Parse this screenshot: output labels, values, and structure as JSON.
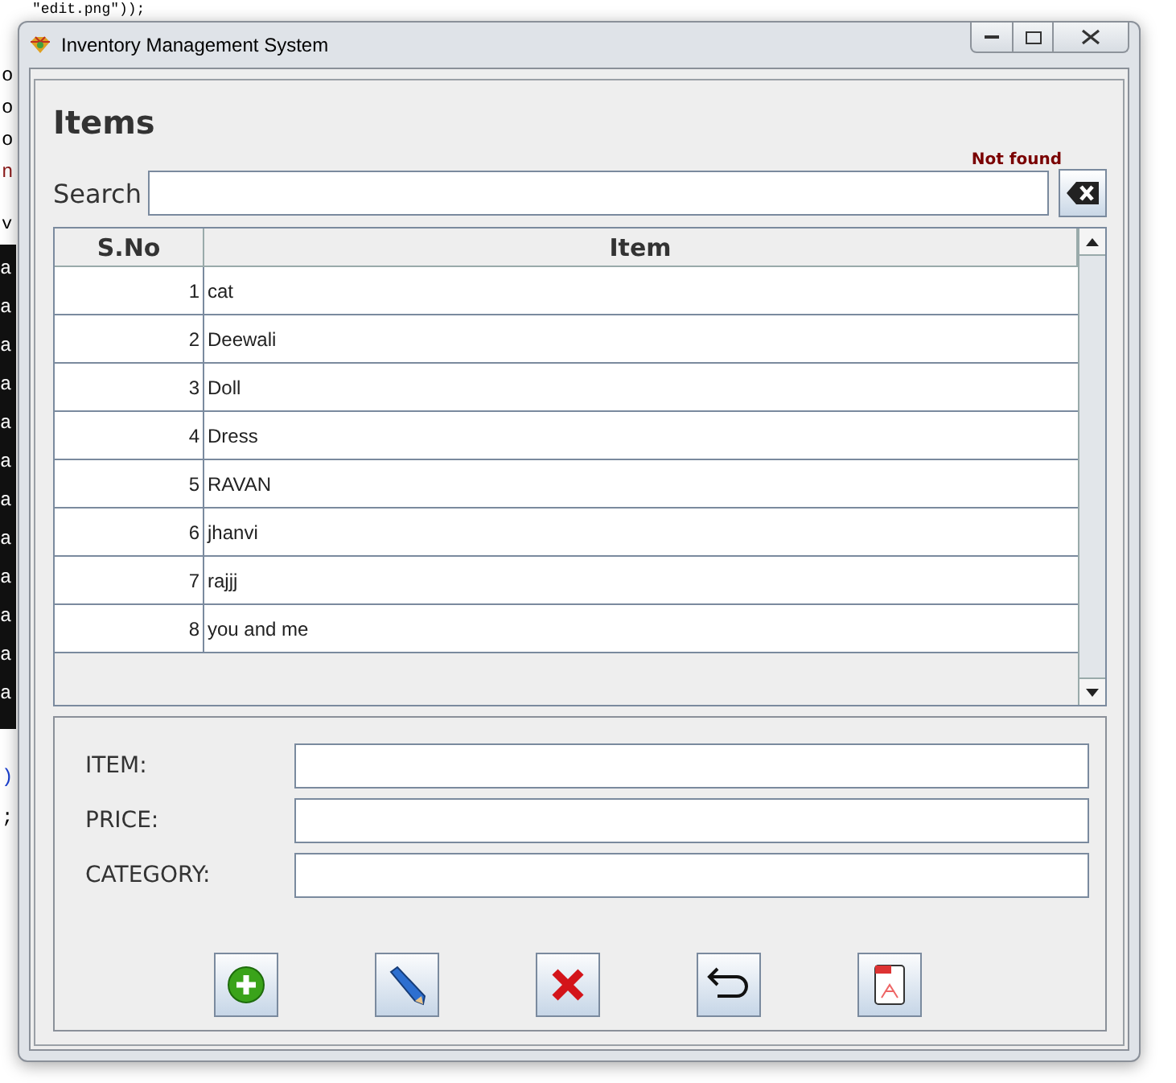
{
  "background_text": {
    "top_line": "\"edit.png\"));",
    "side_lines": [
      "o",
      "o",
      "o",
      "n"
    ],
    "tab_label": "v",
    "console_lines": [
      "a",
      "a",
      "a",
      "a",
      "a",
      "a",
      "a",
      "a",
      "a",
      "a",
      "a",
      "a"
    ],
    "bottom_lines": [
      ")",
      ";"
    ]
  },
  "window": {
    "title": "Inventory Management System"
  },
  "heading": "Items",
  "status_message": "Not found",
  "search": {
    "label": "Search"
  },
  "table": {
    "columns": [
      "S.No",
      "Item"
    ],
    "rows": [
      {
        "sno": "1",
        "item": "cat"
      },
      {
        "sno": "2",
        "item": "Deewali"
      },
      {
        "sno": "3",
        "item": "Doll"
      },
      {
        "sno": "4",
        "item": "Dress"
      },
      {
        "sno": "5",
        "item": "RAVAN"
      },
      {
        "sno": "6",
        "item": "jhanvi"
      },
      {
        "sno": "7",
        "item": "rajjj"
      },
      {
        "sno": "8",
        "item": "you and me"
      }
    ]
  },
  "form": [
    {
      "label": "ITEM:"
    },
    {
      "label": "PRICE:"
    },
    {
      "label": "CATEGORY:"
    }
  ],
  "buttons": [
    {
      "kind": "add"
    },
    {
      "kind": "edit"
    },
    {
      "kind": "delete"
    },
    {
      "kind": "undo"
    },
    {
      "kind": "pdf"
    }
  ]
}
